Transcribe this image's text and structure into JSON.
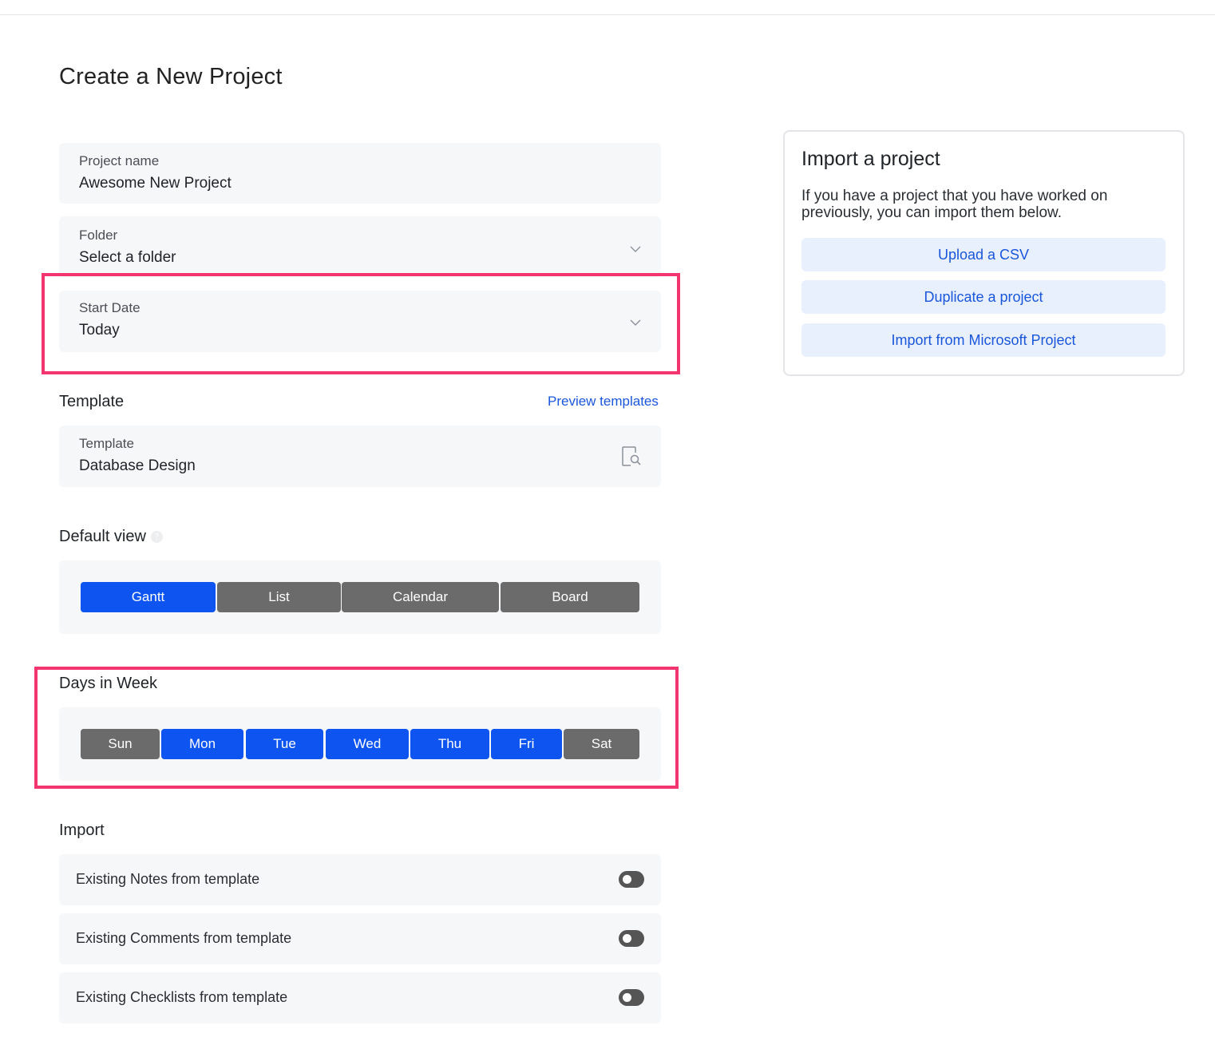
{
  "page": {
    "title": "Create a New Project"
  },
  "form": {
    "project_name": {
      "label": "Project name",
      "value": "Awesome New Project"
    },
    "folder": {
      "label": "Folder",
      "value": "Select a folder"
    },
    "start_date": {
      "label": "Start Date",
      "value": "Today"
    },
    "template_section": {
      "title": "Template",
      "preview_link": "Preview templates",
      "label": "Template",
      "value": "Database Design"
    },
    "default_view": {
      "title": "Default view",
      "options": [
        {
          "label": "Gantt",
          "selected": true
        },
        {
          "label": "List",
          "selected": false
        },
        {
          "label": "Calendar",
          "selected": false
        },
        {
          "label": "Board",
          "selected": false
        }
      ]
    },
    "days_in_week": {
      "title": "Days in Week",
      "days": [
        {
          "label": "Sun",
          "selected": false
        },
        {
          "label": "Mon",
          "selected": true
        },
        {
          "label": "Tue",
          "selected": true
        },
        {
          "label": "Wed",
          "selected": true
        },
        {
          "label": "Thu",
          "selected": true
        },
        {
          "label": "Fri",
          "selected": true
        },
        {
          "label": "Sat",
          "selected": false
        }
      ]
    },
    "import": {
      "title": "Import",
      "options": [
        {
          "label": "Existing Notes from template",
          "enabled": false
        },
        {
          "label": "Existing Comments from template",
          "enabled": false
        },
        {
          "label": "Existing Checklists from template",
          "enabled": false
        }
      ]
    }
  },
  "import_card": {
    "title": "Import a project",
    "description": "If you have a project that you have worked on previously, you can import them below.",
    "buttons": {
      "csv": "Upload a CSV",
      "duplicate": "Duplicate a project",
      "ms_project": "Import from Microsoft Project"
    }
  },
  "colors": {
    "accent": "#0e54f0",
    "link": "#1a56db",
    "unselected": "#6b6b6b",
    "highlight": "#f2356f",
    "field_bg": "#f6f7f9"
  },
  "icons": {
    "dropdown": "chevron-down-icon",
    "template_search": "document-search-icon",
    "help": "help-circle-icon"
  }
}
